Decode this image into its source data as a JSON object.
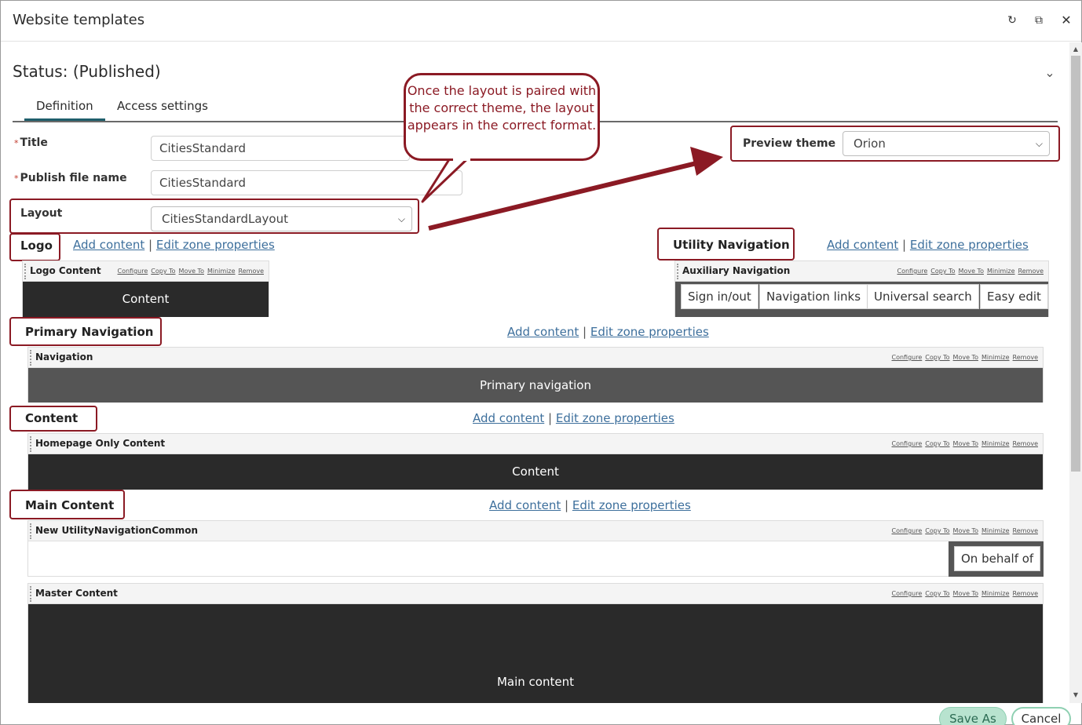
{
  "window": {
    "title": "Website templates",
    "refresh_icon": "refresh-icon",
    "restore_icon": "restore-icon",
    "close_icon": "close-icon"
  },
  "status": "Status: (Published)",
  "tabs": [
    {
      "label": "Definition",
      "active": true
    },
    {
      "label": "Access settings",
      "active": false
    }
  ],
  "form": {
    "title_label": "Title",
    "title_value": "CitiesStandard",
    "publish_label": "Publish file name",
    "publish_value": "CitiesStandard",
    "layout_label": "Layout",
    "layout_value": "CitiesStandardLayout",
    "preview_label": "Preview theme",
    "preview_value": "Orion"
  },
  "callout": "Once the layout is paired with the correct theme, the layout appears in the correct format.",
  "links": {
    "add": "Add content",
    "edit": "Edit zone properties",
    "sep": "|"
  },
  "widget_actions": [
    "Configure",
    "Copy To",
    "Move To",
    "Minimize",
    "Remove"
  ],
  "zones": {
    "logo": {
      "title": "Logo",
      "widget": "Logo Content",
      "body": "Content"
    },
    "utility": {
      "title": "Utility Navigation",
      "widget": "Auxiliary Navigation",
      "items": [
        "Sign in/out",
        "Navigation links",
        "Universal search",
        "Easy edit"
      ]
    },
    "primary": {
      "title": "Primary Navigation",
      "widget": "Navigation",
      "body": "Primary navigation"
    },
    "content": {
      "title": "Content",
      "widget": "Homepage Only Content",
      "body": "Content"
    },
    "main": {
      "title": "Main Content",
      "widget1": "New UtilityNavigationCommon",
      "widget1_item": "On behalf of",
      "widget2": "Master Content",
      "body": "Main content"
    }
  },
  "buttons": {
    "save_as": "Save As",
    "cancel": "Cancel"
  },
  "colors": {
    "accent_red": "#8b1a24",
    "link": "#3d6f9c",
    "tab_underline": "#1f5e6b",
    "dark_body": "#2a2a2a",
    "nav_body": "#555555"
  }
}
